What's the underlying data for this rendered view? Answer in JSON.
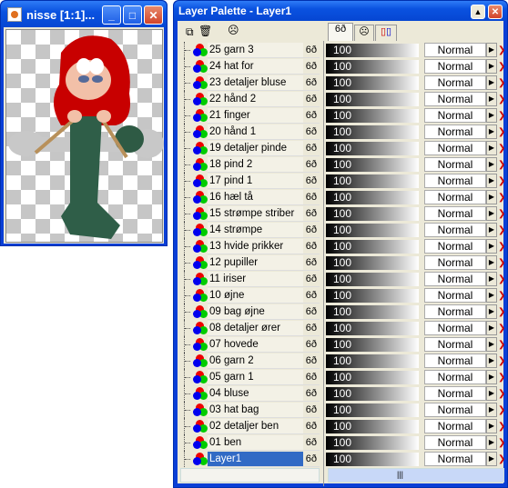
{
  "image_window": {
    "title": "nisse [1:1]...",
    "buttons": [
      "minimize",
      "maximize",
      "close"
    ]
  },
  "palette": {
    "title": "Layer Palette - Layer1",
    "toolbar": [
      "duplicate-layer-icon",
      "delete-layer-icon",
      "mask-icon"
    ],
    "tabs": [
      "visibility-tab",
      "mask-tab",
      "groups-tab"
    ],
    "layers": [
      {
        "name": "25 garn 3",
        "opacity": "100",
        "blend": "Normal"
      },
      {
        "name": "24 hat for",
        "opacity": "100",
        "blend": "Normal"
      },
      {
        "name": "23 detaljer bluse",
        "opacity": "100",
        "blend": "Normal"
      },
      {
        "name": "22 hånd 2",
        "opacity": "100",
        "blend": "Normal"
      },
      {
        "name": "21 finger",
        "opacity": "100",
        "blend": "Normal"
      },
      {
        "name": "20 hånd 1",
        "opacity": "100",
        "blend": "Normal"
      },
      {
        "name": "19 detaljer pinde",
        "opacity": "100",
        "blend": "Normal"
      },
      {
        "name": "18 pind 2",
        "opacity": "100",
        "blend": "Normal"
      },
      {
        "name": "17 pind 1",
        "opacity": "100",
        "blend": "Normal"
      },
      {
        "name": "16 hæl tå",
        "opacity": "100",
        "blend": "Normal"
      },
      {
        "name": "15 strømpe striber",
        "opacity": "100",
        "blend": "Normal"
      },
      {
        "name": "14 strømpe",
        "opacity": "100",
        "blend": "Normal"
      },
      {
        "name": "13 hvide prikker",
        "opacity": "100",
        "blend": "Normal"
      },
      {
        "name": "12 pupiller",
        "opacity": "100",
        "blend": "Normal"
      },
      {
        "name": "11 iriser",
        "opacity": "100",
        "blend": "Normal"
      },
      {
        "name": "10 øjne",
        "opacity": "100",
        "blend": "Normal"
      },
      {
        "name": "09 bag øjne",
        "opacity": "100",
        "blend": "Normal"
      },
      {
        "name": "08 detaljer ører",
        "opacity": "100",
        "blend": "Normal"
      },
      {
        "name": "07 hovede",
        "opacity": "100",
        "blend": "Normal"
      },
      {
        "name": "06 garn 2",
        "opacity": "100",
        "blend": "Normal"
      },
      {
        "name": "05 garn 1",
        "opacity": "100",
        "blend": "Normal"
      },
      {
        "name": "04 bluse",
        "opacity": "100",
        "blend": "Normal"
      },
      {
        "name": "03 hat bag",
        "opacity": "100",
        "blend": "Normal"
      },
      {
        "name": "02 detaljer ben",
        "opacity": "100",
        "blend": "Normal"
      },
      {
        "name": "01 ben",
        "opacity": "100",
        "blend": "Normal"
      },
      {
        "name": "Layer1",
        "opacity": "100",
        "blend": "Normal",
        "selected": true
      }
    ],
    "visibility_glyph": "6ð",
    "colors": {
      "selection": "#316ac5",
      "titlebar": "#0a52e0"
    }
  }
}
